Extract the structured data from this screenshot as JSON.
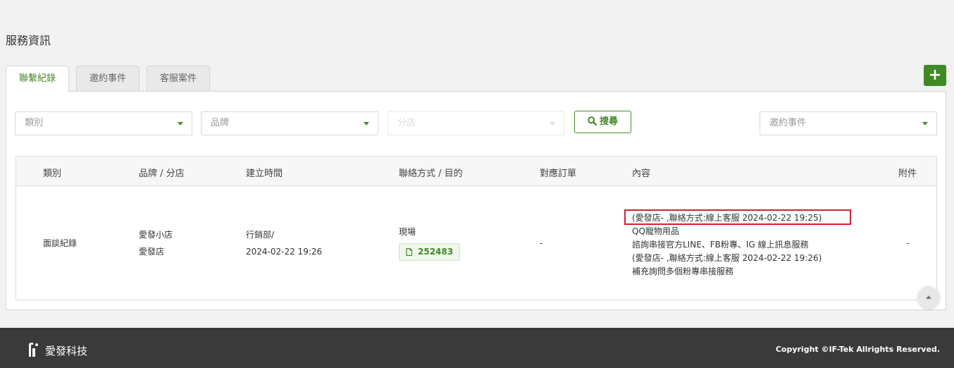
{
  "section_title": "服務資訊",
  "tabs": [
    {
      "label": "聯繫紀錄",
      "active": true
    },
    {
      "label": "邀約事件",
      "active": false
    },
    {
      "label": "客服案件",
      "active": false
    }
  ],
  "add_button": "+",
  "filters": {
    "category": "類別",
    "brand": "品牌",
    "branch": "分店",
    "search_label": "搜尋",
    "invite_event": "邀約事件"
  },
  "table": {
    "headers": [
      "類別",
      "品牌 / 分店",
      "建立時間",
      "聯絡方式 / 目的",
      "對應訂單",
      "內容",
      "附件"
    ],
    "row": {
      "category": "面談紀錄",
      "brand": "愛發小店",
      "branch": "愛發店",
      "creator": "行銷部/ ",
      "created_at": "2024-02-22 19:26",
      "contact_method": "現場",
      "order_id": "252483",
      "mapped_order": "-",
      "content": [
        "(愛發店-     ,聯絡方式:線上客服 2024-02-22 19:25)",
        "QQ寵物用品",
        "諮詢串接官方LINE、FB粉專、IG 線上訊息服務",
        "(愛發店-     ,聯絡方式:線上客服 2024-02-22 19:26)",
        "補充詢問多個粉專串接服務"
      ],
      "attachment": "-"
    }
  },
  "footer": {
    "brand": "愛發科技",
    "copyright": "Copyright ©IF-Tek Allrights Reserved."
  },
  "colors": {
    "accent": "#3f8a25",
    "highlight_box": "#d7212e",
    "footer_bg": "#3a3a3a"
  }
}
